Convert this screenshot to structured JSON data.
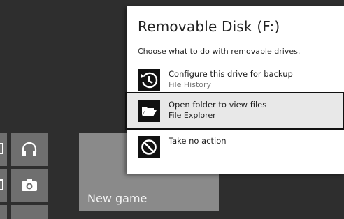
{
  "start": {
    "tiles": [
      {
        "icon": "headphones-icon"
      },
      {
        "icon": "camera-icon"
      }
    ],
    "new_game_label": "New game"
  },
  "autoplay": {
    "title": "Removable Disk (F:)",
    "subtitle": "Choose what to do with removable drives.",
    "options": [
      {
        "title": "Configure this drive for backup",
        "subtitle": "File History",
        "icon": "file-history-icon"
      },
      {
        "title": "Open folder to view files",
        "subtitle": "File Explorer",
        "icon": "folder-icon",
        "selected": true
      },
      {
        "title": "Take no action",
        "subtitle": "",
        "icon": "no-action-icon"
      }
    ]
  }
}
